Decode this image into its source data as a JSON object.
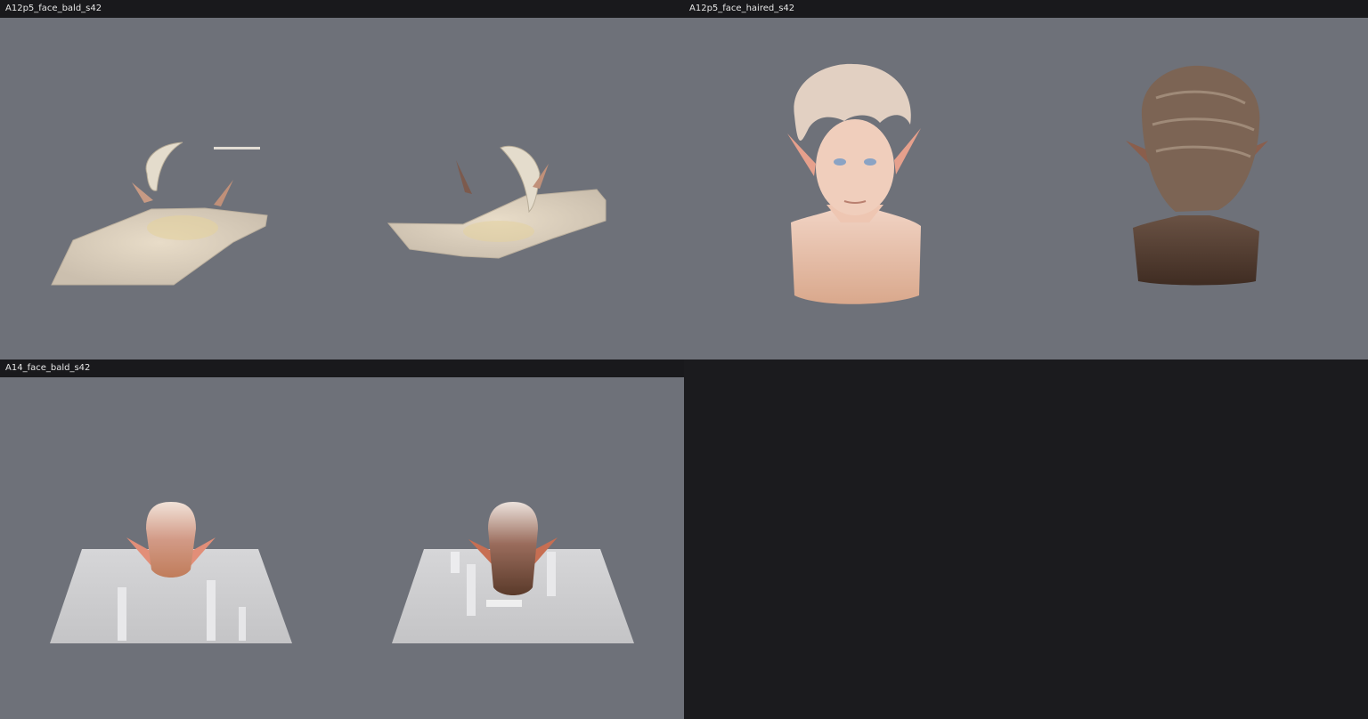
{
  "panels": [
    {
      "title": "A12p5_face_bald_s42"
    },
    {
      "title": "A12p5_face_haired_s42"
    },
    {
      "title": "A14_face_bald_s42"
    }
  ],
  "colors": {
    "background": "#1b1b1e",
    "header": "#19191c",
    "viewport": "#6e7179",
    "header_text": "#e6e6e6"
  }
}
